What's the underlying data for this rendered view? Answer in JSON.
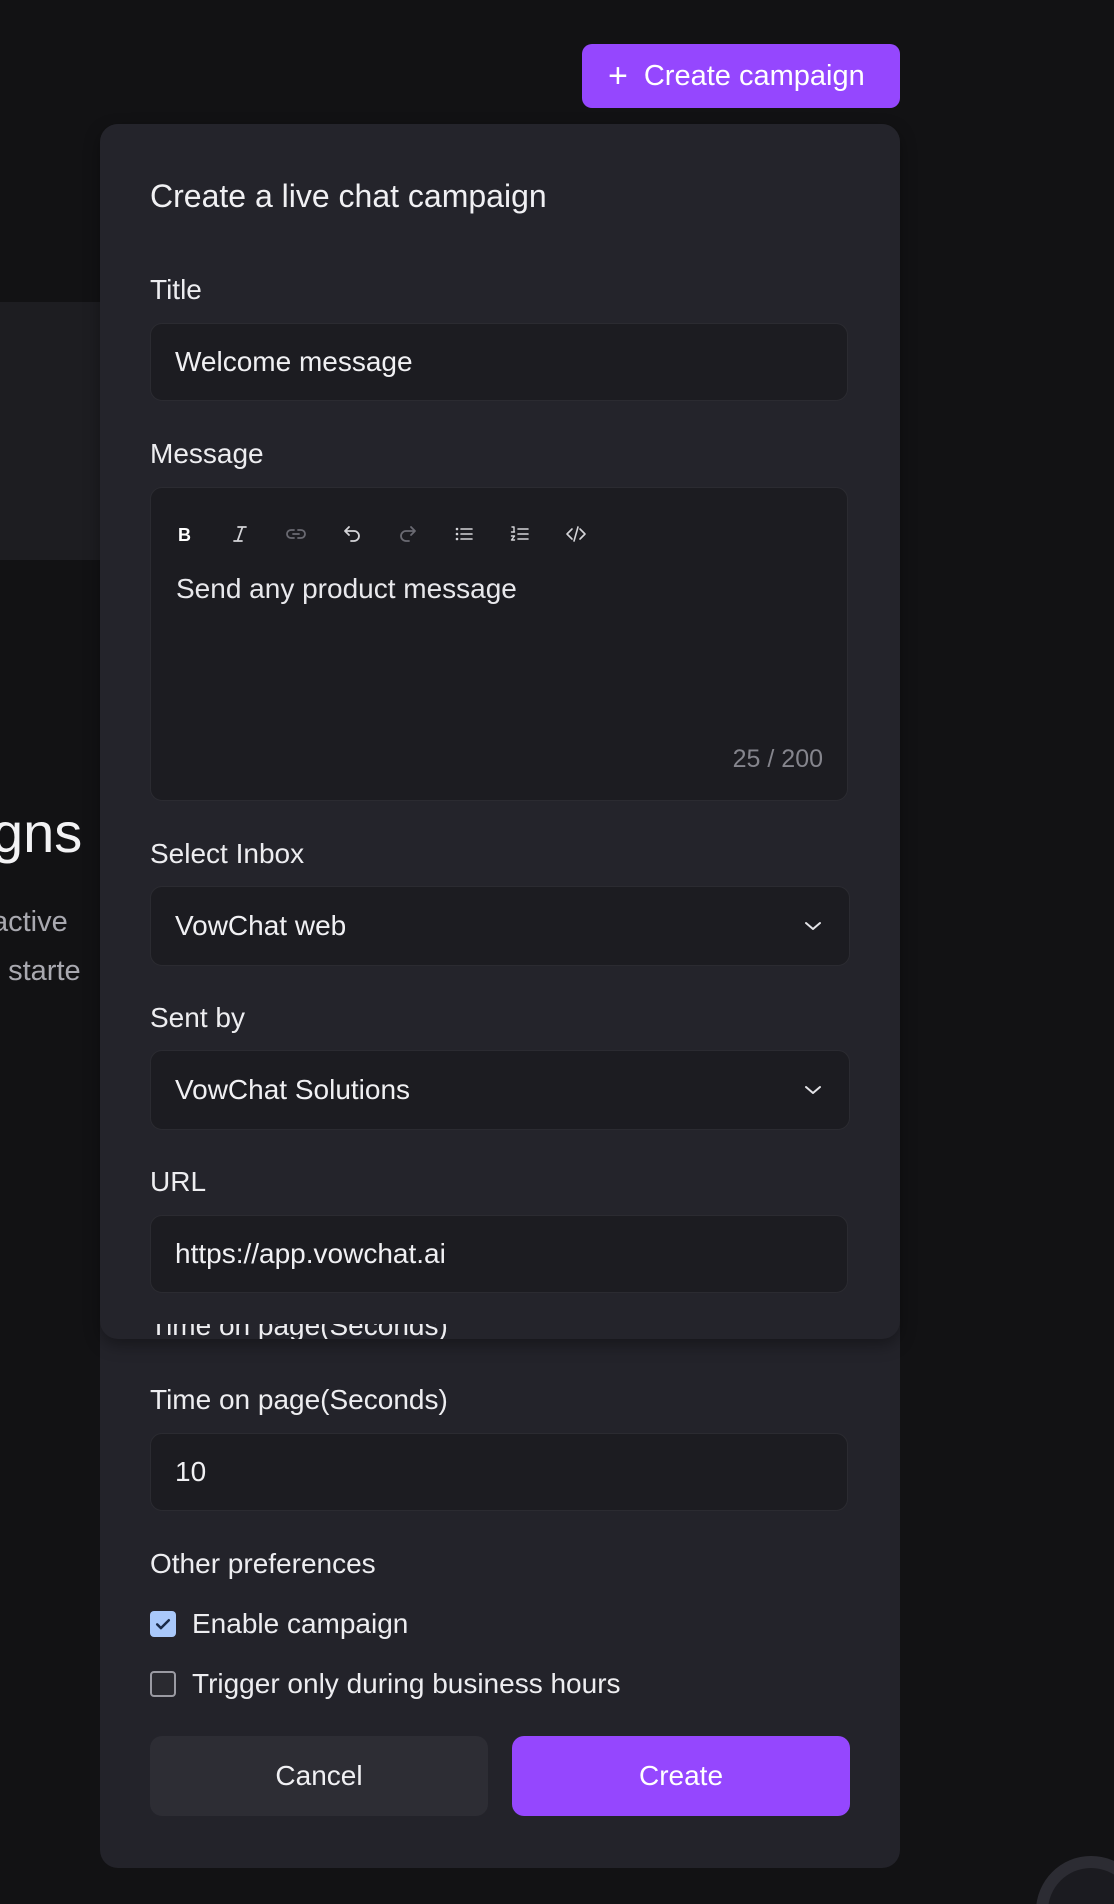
{
  "header": {
    "create_campaign_label": "Create campaign"
  },
  "background": {
    "heading_fragment": "gns a",
    "desc_line1": "active",
    "desc_line2": "t starte"
  },
  "modal": {
    "title": "Create a live chat campaign",
    "fields": {
      "title_label": "Title",
      "title_value": "Welcome message",
      "message_label": "Message",
      "message_value": "Send any product message",
      "message_count": "25 / 200",
      "inbox_label": "Select Inbox",
      "inbox_value": "VowChat web",
      "sender_label": "Sent by",
      "sender_value": "VowChat Solutions",
      "url_label": "URL",
      "url_value": "https://app.vowchat.ai",
      "time_label": "Time on page(Seconds)",
      "time_value": "10"
    },
    "toolbar": [
      "bold-icon",
      "italic-icon",
      "link-icon",
      "undo-icon",
      "redo-icon",
      "bullet-list-icon",
      "ordered-list-icon",
      "code-icon"
    ],
    "preferences": {
      "label": "Other preferences",
      "enable_campaign": {
        "label": "Enable campaign",
        "checked": true
      },
      "business_hours": {
        "label": "Trigger only during business hours",
        "checked": false
      }
    },
    "buttons": {
      "cancel": "Cancel",
      "create": "Create"
    }
  },
  "colors": {
    "accent": "#9547fe",
    "modal_bg": "#23232a",
    "field_bg": "#1c1c21",
    "checkbox_checked": "#a9c8fa"
  }
}
